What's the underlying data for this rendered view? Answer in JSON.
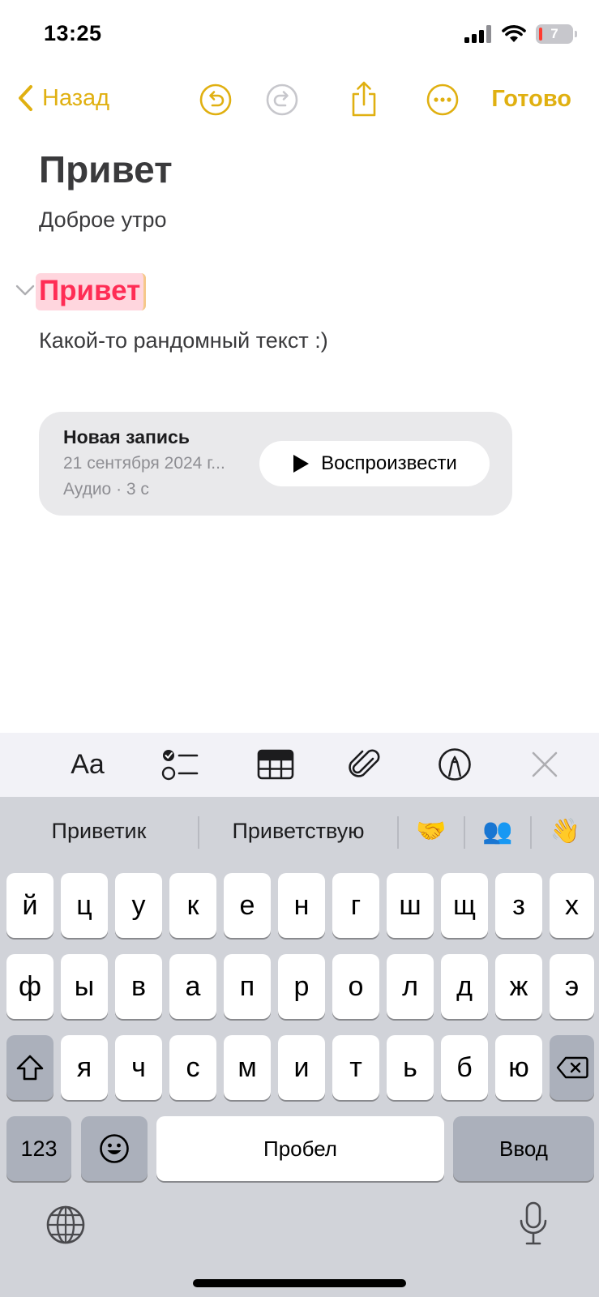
{
  "status_bar": {
    "time": "13:25",
    "battery_level": "7",
    "icons": [
      "cellular-signal-icon",
      "wifi-icon",
      "battery-icon"
    ]
  },
  "toolbar": {
    "back_label": "Назад",
    "done_label": "Готово",
    "icons": [
      "undo-icon",
      "redo-icon",
      "share-icon",
      "more-icon"
    ],
    "accent_color": "#e0b011"
  },
  "note": {
    "title": "Привет",
    "subtitle": "Доброе утро",
    "section_heading": "Привет",
    "body": "Какой-то рандомный текст :)"
  },
  "audio": {
    "title": "Новая запись",
    "date": "21 сентября 2024 г...",
    "meta": "Аудио · 3 с",
    "play_label": "Воспроизвести"
  },
  "format_bar": {
    "text_style_label": "Aa",
    "icons": [
      "checklist-icon",
      "table-icon",
      "attachment-icon",
      "markup-icon",
      "close-icon"
    ]
  },
  "keyboard": {
    "suggestions": [
      "Приветик",
      "Приветствую",
      "🤝",
      "👥",
      "👋"
    ],
    "row1": [
      "й",
      "ц",
      "у",
      "к",
      "е",
      "н",
      "г",
      "ш",
      "щ",
      "з",
      "х"
    ],
    "row2": [
      "ф",
      "ы",
      "в",
      "а",
      "п",
      "р",
      "о",
      "л",
      "д",
      "ж",
      "э"
    ],
    "row3": [
      "я",
      "ч",
      "с",
      "м",
      "и",
      "т",
      "ь",
      "б",
      "ю"
    ],
    "numbers_label": "123",
    "space_label": "Пробел",
    "return_label": "Ввод"
  }
}
